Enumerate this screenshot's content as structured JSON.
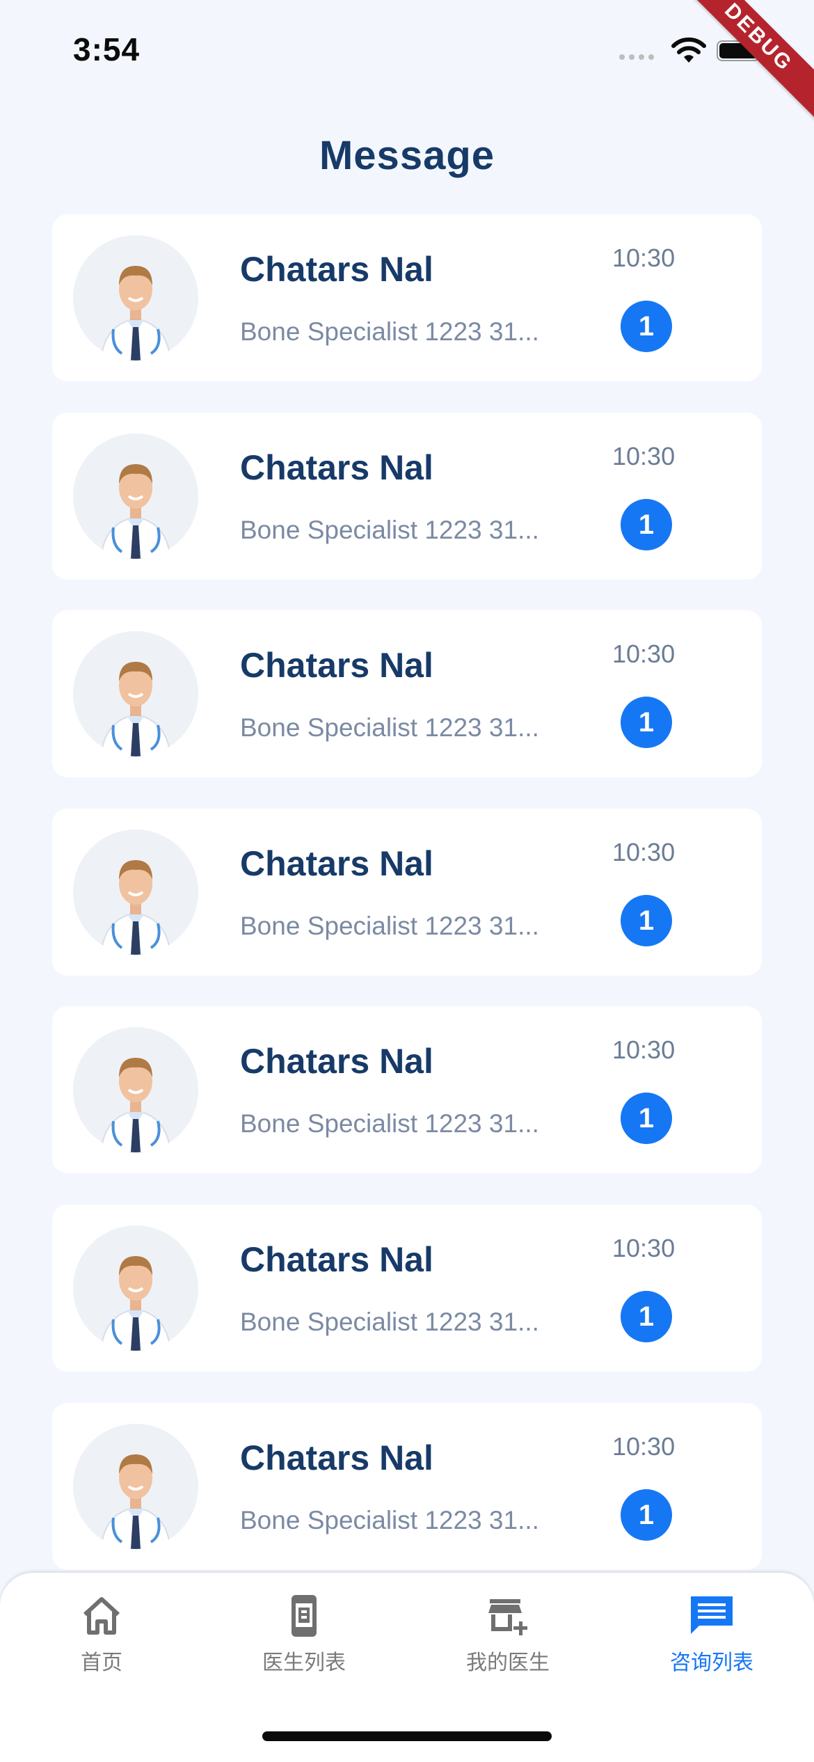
{
  "status_bar": {
    "time": "3:54"
  },
  "debug_banner": "DEBUG",
  "header": {
    "title": "Message"
  },
  "messages": [
    {
      "name": "Chatars Nal",
      "description": "Bone Specialist 1223 31...",
      "time": "10:30",
      "unread": "1"
    },
    {
      "name": "Chatars Nal",
      "description": "Bone Specialist 1223 31...",
      "time": "10:30",
      "unread": "1"
    },
    {
      "name": "Chatars Nal",
      "description": "Bone Specialist 1223 31...",
      "time": "10:30",
      "unread": "1"
    },
    {
      "name": "Chatars Nal",
      "description": "Bone Specialist 1223 31...",
      "time": "10:30",
      "unread": "1"
    },
    {
      "name": "Chatars Nal",
      "description": "Bone Specialist 1223 31...",
      "time": "10:30",
      "unread": "1"
    },
    {
      "name": "Chatars Nal",
      "description": "Bone Specialist 1223 31...",
      "time": "10:30",
      "unread": "1"
    },
    {
      "name": "Chatars Nal",
      "description": "Bone Specialist 1223 31...",
      "time": "10:30",
      "unread": "1"
    }
  ],
  "bottom_nav": {
    "items": [
      {
        "label": "首页",
        "icon": "home-icon",
        "active": false
      },
      {
        "label": "医生列表",
        "icon": "doctor-list-icon",
        "active": false
      },
      {
        "label": "我的医生",
        "icon": "add-store-icon",
        "active": false
      },
      {
        "label": "咨询列表",
        "icon": "message-icon",
        "active": true
      }
    ]
  },
  "colors": {
    "background": "#f3f7fd",
    "title": "#173a68",
    "accent": "#1677f5",
    "inactive_nav": "#7a7a7a",
    "debug": "#b5242d"
  }
}
